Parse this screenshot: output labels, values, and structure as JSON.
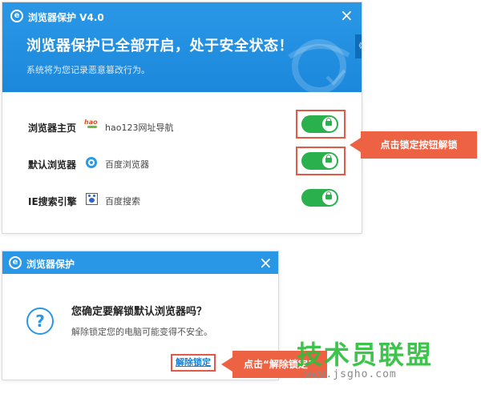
{
  "main_window": {
    "title": "浏览器保护  V4.0",
    "headline": "浏览器保护已全部开启，处于安全状态！",
    "subline": "系统将为您记录恶意篡改行为。",
    "side_tab_glyph": "《",
    "close_glyph": "×",
    "rows": [
      {
        "label": "浏览器主页",
        "icon": "hao123-icon",
        "icon_text": "hao",
        "value": "hao123网址导航",
        "locked": true
      },
      {
        "label": "默认浏览器",
        "icon": "baidu-browser-icon",
        "value": "百度浏览器",
        "locked": true
      },
      {
        "label": "IE搜索引擎",
        "icon": "baidu-paw-icon",
        "value": "百度搜索",
        "locked": true
      }
    ]
  },
  "callouts": {
    "toggle_hint": "点击锁定按钮解锁",
    "unlock_hint": "点击“解除锁定”"
  },
  "dialog": {
    "title": "浏览器保护",
    "close_glyph": "×",
    "question_glyph": "?",
    "question": "您确定要解锁默认浏览器吗？",
    "note": "解除锁定您的电脑可能变得不安全。",
    "unlock_button": "解除锁定"
  },
  "watermark": {
    "brand": "技术员联盟",
    "url": "www.jsgho.com"
  },
  "colors": {
    "header_blue": "#2a97e6",
    "toggle_green": "#2ab04c",
    "callout_orange": "#ee6244",
    "watermark_green": "#2dbf3c"
  }
}
